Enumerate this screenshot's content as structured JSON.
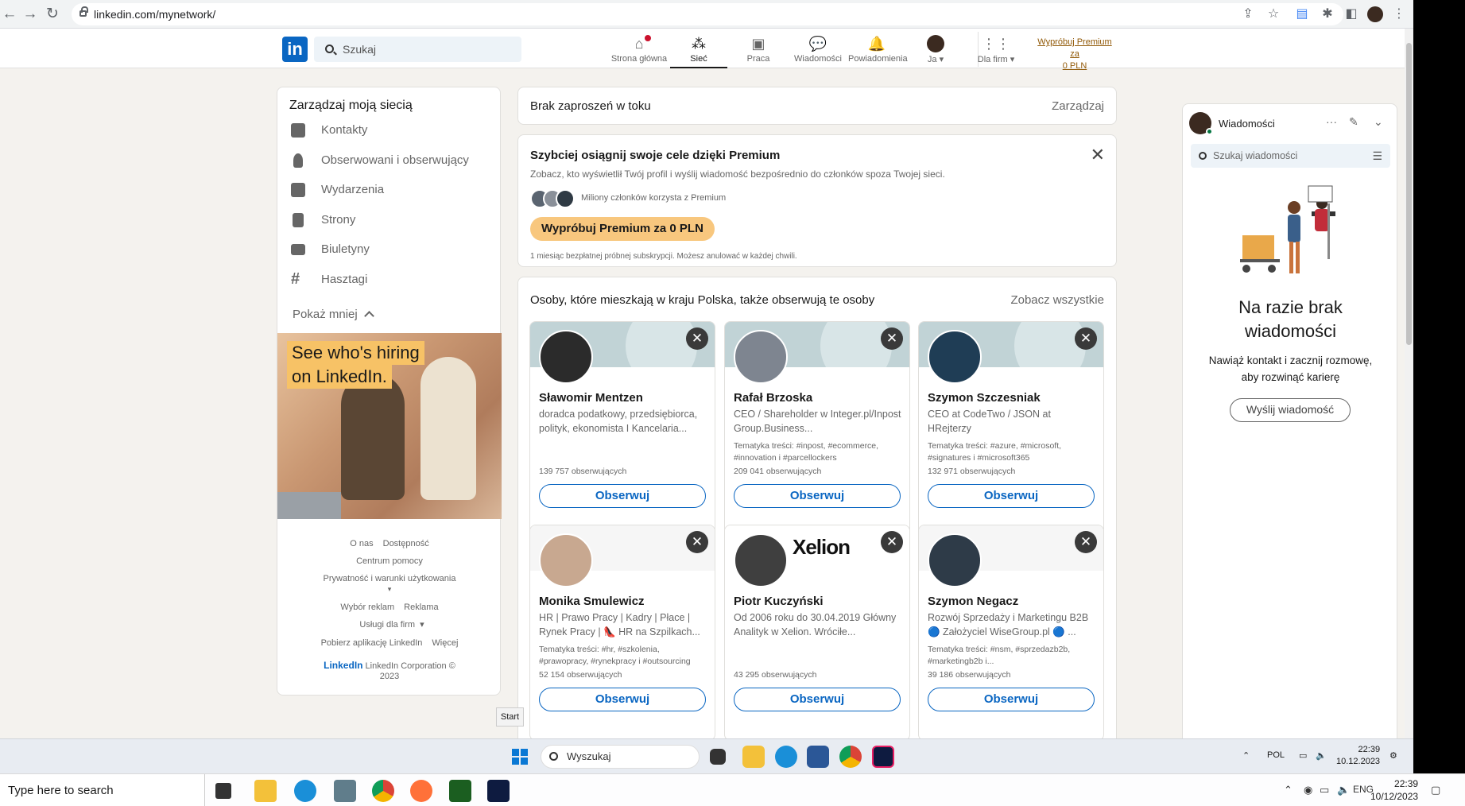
{
  "browser": {
    "url": "linkedin.com/mynetwork/"
  },
  "nav": {
    "search_placeholder": "Szukaj",
    "items": [
      {
        "label": "Strona główna",
        "icon": "home-icon"
      },
      {
        "label": "Sieć",
        "icon": "network-icon"
      },
      {
        "label": "Praca",
        "icon": "briefcase-icon"
      },
      {
        "label": "Wiadomości",
        "icon": "chat-icon"
      },
      {
        "label": "Powiadomienia",
        "icon": "bell-icon"
      },
      {
        "label": "Ja ▾",
        "icon": "avatar"
      },
      {
        "label": "Dla firm ▾",
        "icon": "grid-icon"
      }
    ],
    "premium_link_line1": "Wypróbuj Premium za",
    "premium_link_line2": "0 PLN"
  },
  "left": {
    "title": "Zarządzaj moją siecią",
    "items": [
      {
        "label": "Kontakty",
        "icon": "people-icon"
      },
      {
        "label": "Obserwowani i obserwujący",
        "icon": "person-icon"
      },
      {
        "label": "Wydarzenia",
        "icon": "calendar-icon"
      },
      {
        "label": "Strony",
        "icon": "building-icon"
      },
      {
        "label": "Biuletyny",
        "icon": "newsletter-icon"
      },
      {
        "label": "Hasztagi",
        "icon": "hashtag-icon"
      }
    ],
    "show_less": "Pokaż mniej",
    "ad_line1": "See who's hiring",
    "ad_line2": "on LinkedIn.",
    "footer": {
      "about": "O nas",
      "accessibility": "Dostępność",
      "help": "Centrum pomocy",
      "privacy": "Prywatność i warunki użytkowania",
      "ad_choices": "Wybór reklam",
      "advertising": "Reklama",
      "business": "Usługi dla firm",
      "app": "Pobierz aplikację LinkedIn",
      "more": "Więcej",
      "brand": "LinkedIn",
      "copyright_1": "LinkedIn Corporation ©",
      "copyright_2": "2023"
    }
  },
  "invites": {
    "text": "Brak zaproszeń w toku",
    "manage": "Zarządzaj"
  },
  "premium": {
    "heading": "Szybciej osiągnij swoje cele dzięki Premium",
    "subtitle": "Zobacz, kto wyświetlił Twój profil i wyślij wiadomość bezpośrednio do członków spoza Twojej sieci.",
    "members": "Miliony członków korzysta z Premium",
    "button": "Wypróbuj Premium za 0 PLN",
    "fine_print": "1 miesiąc bezpłatnej próbnej subskrypcji. Możesz anulować w każdej chwili."
  },
  "people": {
    "heading": "Osoby, które mieszkają w kraju Polska, także obserwują te osoby",
    "see_all": "Zobacz wszystkie",
    "follow_label": "Obserwuj",
    "cards": [
      {
        "name": "Sławomir Mentzen",
        "desc": "doradca podatkowy, przedsiębiorca, polityk, ekonomista I Kancelaria...",
        "tags": "",
        "followers": "139 757 obserwujących"
      },
      {
        "name": "Rafał Brzoska",
        "desc": "CEO / Shareholder w Integer.pl/Inpost Group.Business...",
        "tags": "Tematyka treści: #inpost, #ecommerce, #innovation i #parcellockers",
        "followers": "209 041 obserwujących"
      },
      {
        "name": "Szymon Szczesniak",
        "desc": "CEO at CodeTwo / JSON at HRejterzy",
        "tags": "Tematyka treści: #azure, #microsoft, #signatures i #microsoft365",
        "followers": "132 971 obserwujących"
      },
      {
        "name": "Monika Smulewicz",
        "desc": "HR | Prawo Pracy | Kadry | Płace | Rynek Pracy | 👠 HR na Szpilkach...",
        "tags": "Tematyka treści: #hr, #szkolenia, #prawopracy, #rynekpracy i #outsourcing",
        "followers": "52 154 obserwujących"
      },
      {
        "name": "Piotr Kuczyński",
        "desc": "Od 2006 roku do 30.04.2019 Główny Analityk w Xelion. Wróciłe...",
        "tags": "",
        "followers": "43 295 obserwujących",
        "banner_text": "Xelion"
      },
      {
        "name": "Szymon Negacz",
        "desc": "Rozwój Sprzedaży i Marketingu B2B 🔵 Założyciel WiseGroup.pl 🔵 ...",
        "tags": "Tematyka treści: #nsm, #sprzedazb2b, #marketingb2b i...",
        "followers": "39 186 obserwujących"
      }
    ]
  },
  "messaging": {
    "title": "Wiadomości",
    "search_placeholder": "Szukaj wiadomości",
    "empty_title_1": "Na razie brak",
    "empty_title_2": "wiadomości",
    "empty_sub_1": "Nawiąż kontakt i zacznij rozmowę,",
    "empty_sub_2": "aby rozwinąć karierę",
    "button": "Wyślij wiadomość"
  },
  "tooltip": "Start",
  "taskbar_inner": {
    "search": "Wyszukaj",
    "lang": "POL",
    "time": "22:39",
    "date": "10.12.2023"
  },
  "taskbar_outer": {
    "search": "Type here to search",
    "lang": "ENG",
    "time": "22:39",
    "date": "10/12/2023"
  },
  "colors": {
    "linkedin_blue": "#0a66c2",
    "premium_gold": "#f8c77e",
    "page_bg": "#f4f2ee"
  }
}
